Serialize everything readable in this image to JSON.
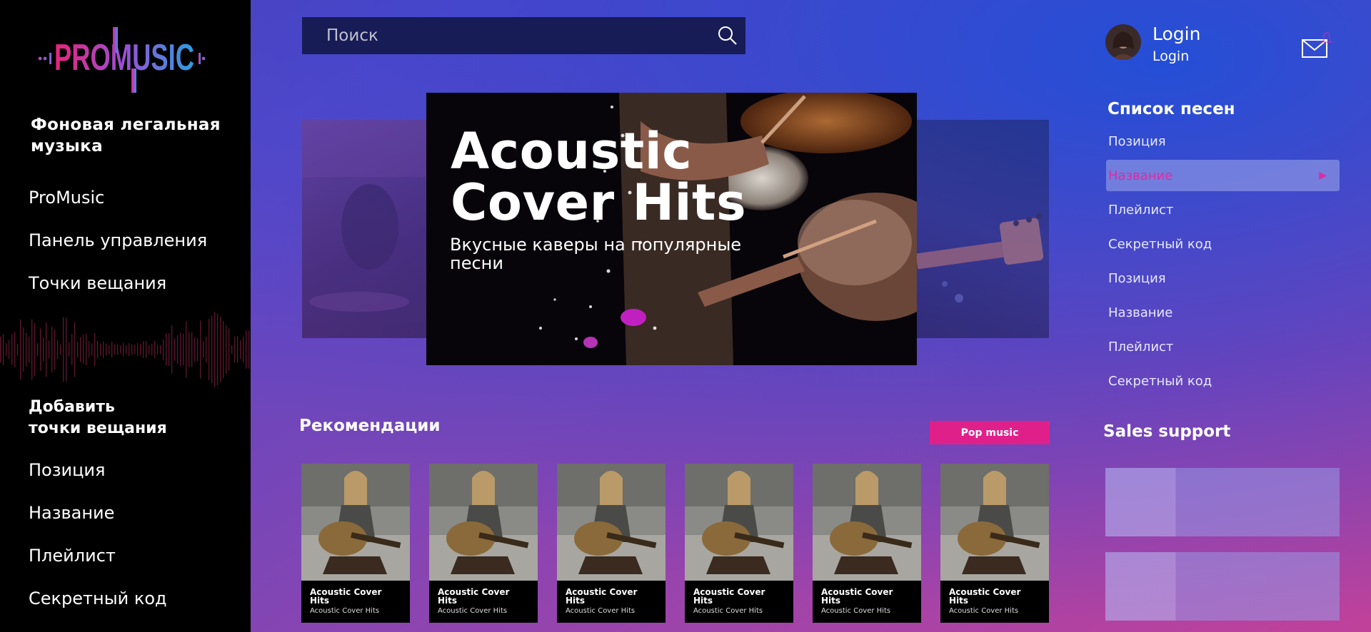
{
  "sidebar": {
    "logo_text": "PROMUSIC",
    "tagline": "Фоновая легальная музыка",
    "nav": [
      "ProMusic",
      "Панель управления",
      "Точки вещания"
    ],
    "section_title_line1": "Добавить",
    "section_title_line2": "точки вещания",
    "nav2": [
      "Позиция",
      "Название",
      "Плейлист",
      "Секретный код"
    ]
  },
  "search": {
    "placeholder": "Поиск",
    "value": ""
  },
  "banner": {
    "title_line1": "Acoustic",
    "title_line2": "Cover Hits",
    "subtitle": "Вкусные каверы на популярные песни"
  },
  "recommendations": {
    "title": "Рекомендации",
    "filter_label": "Pop music",
    "cards": [
      {
        "title_line1": "Acoustic Cover",
        "title_line2": "Hits",
        "subtitle": "Acoustic Cover Hits"
      },
      {
        "title_line1": "Acoustic Cover",
        "title_line2": "Hits",
        "subtitle": "Acoustic Cover Hits"
      },
      {
        "title_line1": "Acoustic Cover",
        "title_line2": "Hits",
        "subtitle": "Acoustic Cover Hits"
      },
      {
        "title_line1": "Acoustic Cover",
        "title_line2": "Hits",
        "subtitle": "Acoustic Cover Hits"
      },
      {
        "title_line1": "Acoustic Cover",
        "title_line2": "Hits",
        "subtitle": "Acoustic Cover Hits"
      },
      {
        "title_line1": "Acoustic Cover",
        "title_line2": "Hits",
        "subtitle": "Acoustic Cover Hits"
      }
    ]
  },
  "user": {
    "name": "Login",
    "sub": "Login"
  },
  "songlist": {
    "title": "Список песен",
    "items": [
      "Позиция",
      "Название",
      "Плейлист",
      "Секретный код",
      "Позиция",
      "Название",
      "Плейлист",
      "Секретный код"
    ],
    "active_index": 1
  },
  "sales": {
    "title": "Sales support"
  },
  "colors": {
    "accent": "#e0208a",
    "sidebar_bg": "#000000",
    "search_bg": "#171c56"
  },
  "icons": {
    "search": "search-icon",
    "mail": "mail-icon",
    "arrow": "play-arrow-icon"
  }
}
